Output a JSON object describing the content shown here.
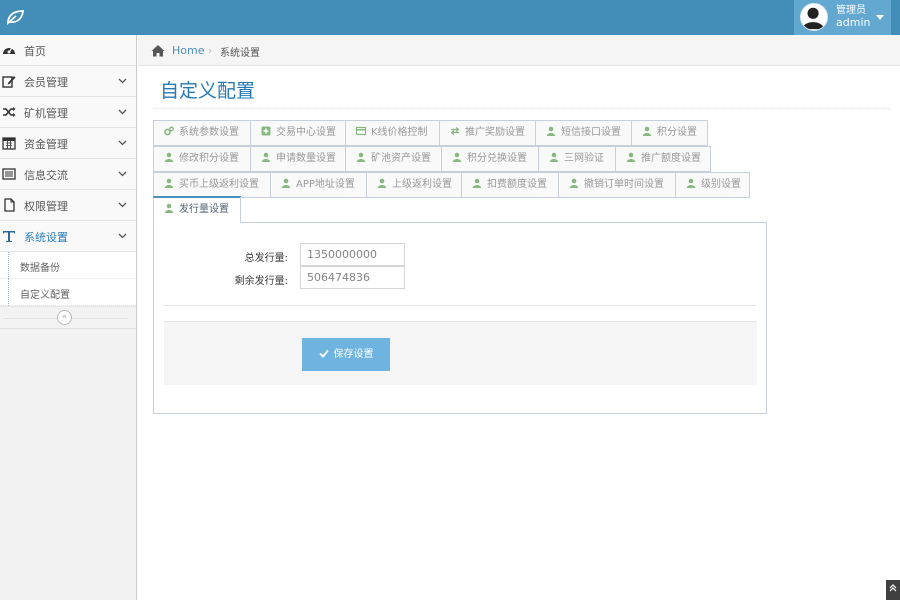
{
  "header": {
    "welcome": "管理员",
    "username": "admin"
  },
  "sidebar": {
    "items": [
      {
        "label": "首页",
        "icon": "dashboard-icon"
      },
      {
        "label": "会员管理",
        "icon": "edit-icon"
      },
      {
        "label": "矿机管理",
        "icon": "random-icon"
      },
      {
        "label": "资金管理",
        "icon": "calendar-icon"
      },
      {
        "label": "信息交流",
        "icon": "list-icon"
      },
      {
        "label": "权限管理",
        "icon": "file-icon"
      },
      {
        "label": "系统设置",
        "icon": "text-icon"
      }
    ],
    "subitems": [
      {
        "label": "数据备份"
      },
      {
        "label": "自定义配置"
      }
    ]
  },
  "breadcrumb": {
    "home": "Home",
    "current": "系统设置"
  },
  "page": {
    "title": "自定义配置"
  },
  "tabs": {
    "row1": [
      "系统参数设置",
      "交易中心设置",
      "K线价格控制",
      "推广奖励设置",
      "短信接口设置",
      "积分设置"
    ],
    "row2": [
      "修改积分设置",
      "申请数量设置",
      "矿池资产设置",
      "积分兑换设置",
      "三网验证",
      "推广额度设置"
    ],
    "row3": [
      "买币上级返利设置",
      "APP地址设置",
      "上级返利设置",
      "扣费额度设置",
      "撤销订单时间设置",
      "级别设置"
    ],
    "row4": [
      "发行量设置"
    ]
  },
  "form": {
    "total_label": "总发行量:",
    "total_value": "1350000000",
    "remain_label": "剩余发行量:",
    "remain_value": "506474836",
    "save_label": "保存设置"
  },
  "colors": {
    "navbar": "#438eb9",
    "accent": "#2679b5",
    "button": "#6fb3e0",
    "tab_icon": "#87b87f"
  }
}
